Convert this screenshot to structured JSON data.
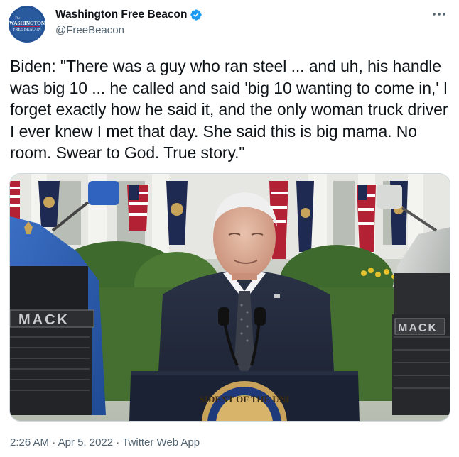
{
  "author": {
    "display_name": "Washington Free Beacon",
    "handle": "@FreeBeacon",
    "verified": true,
    "avatar_text_top": "WASHINGTON",
    "avatar_text_bottom": "FREE BEACON",
    "avatar_text_small": "The"
  },
  "tweet": {
    "text": "Biden: \"There was a guy who ran steel ... and uh, his handle was big 10 ... he called and said 'big 10 wanting to come in,' I forget exactly how he said it, and the only woman truck driver I ever knew I met that day. She said this is big mama. No room. Swear to God. True story.\""
  },
  "media": {
    "left_truck_label": "MACK",
    "right_truck_label": "MACK",
    "seal_text": "SIDENT OF THE UNI"
  },
  "footer": {
    "time": "2:26 AM",
    "separator_1": " · ",
    "date": "Apr 5, 2022",
    "separator_2": " · ",
    "source": "Twitter Web App"
  },
  "icons": {
    "more": "more-horizontal-icon",
    "verified": "verified-badge-icon"
  },
  "colors": {
    "verified": "#1d9bf0",
    "secondary_text": "#536471",
    "primary_text": "#0f1419",
    "avatar_bg": "#2b5797",
    "avatar_text": "#c8102e"
  }
}
